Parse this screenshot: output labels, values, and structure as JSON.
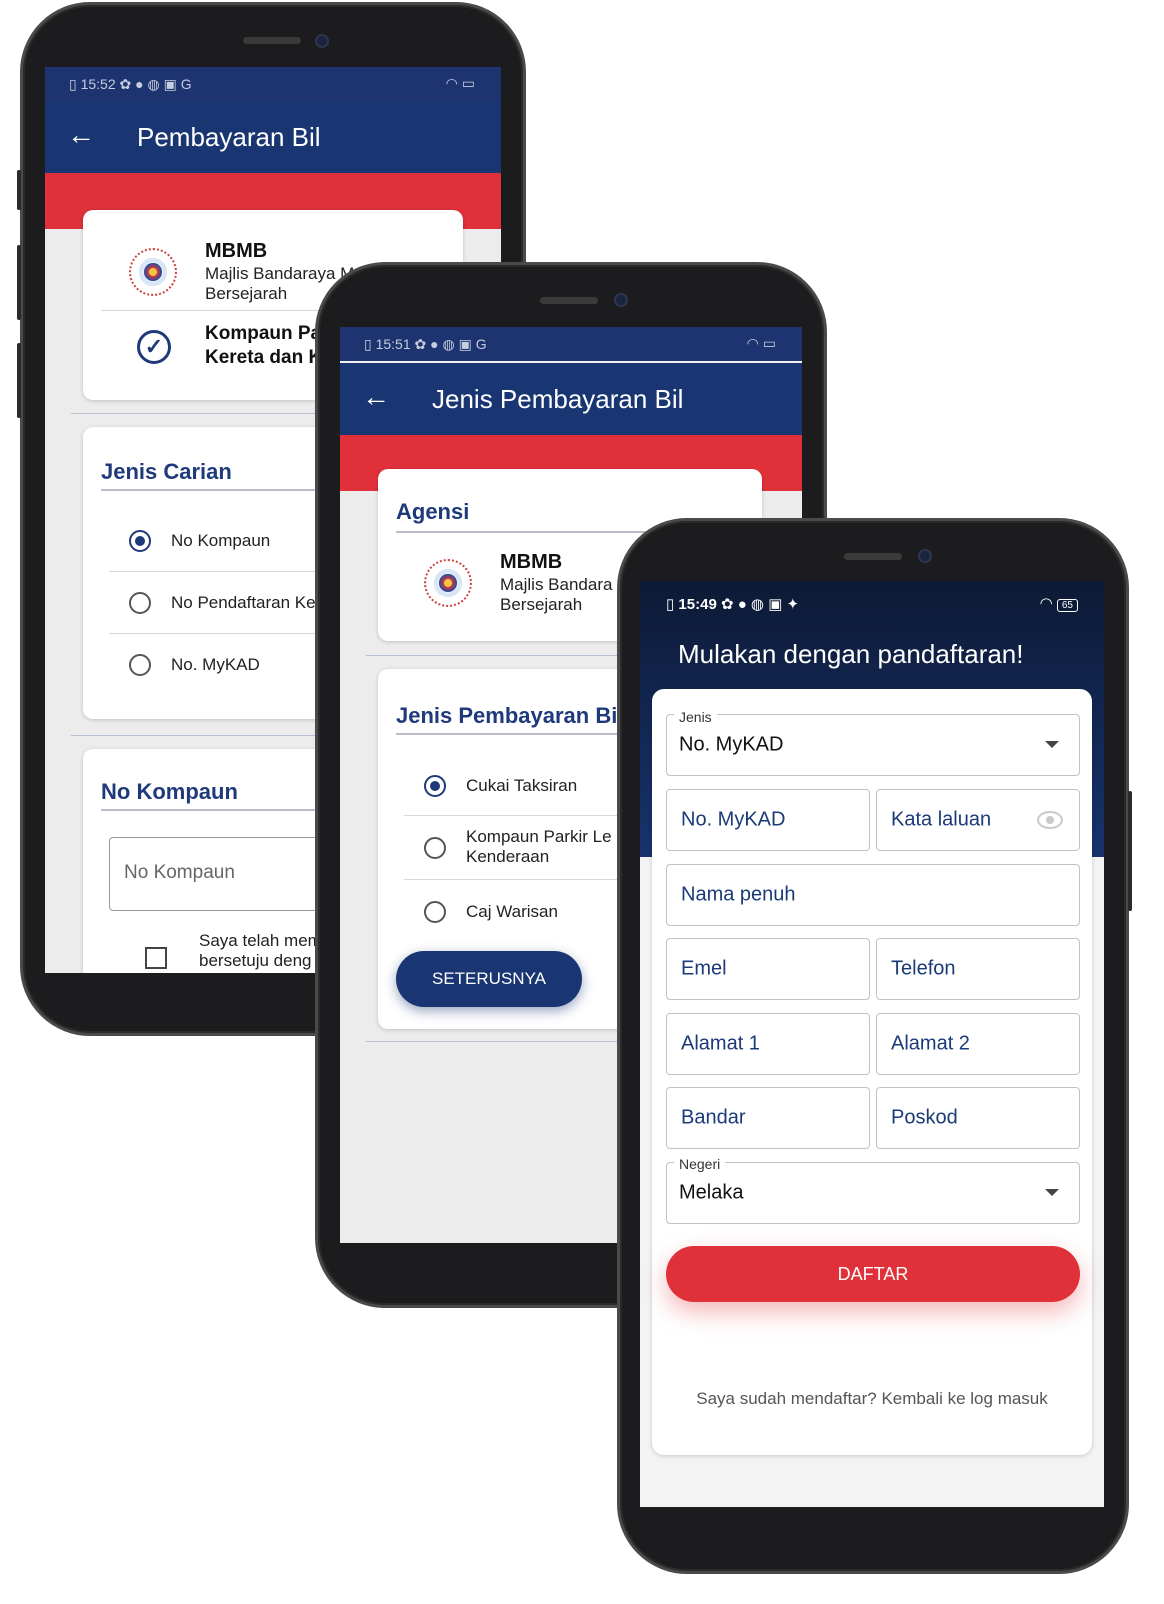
{
  "phone1": {
    "status_time": "15:52",
    "status_icons": "✿ ● ◍ ▣ G",
    "title": "Pembayaran Bil",
    "agency_code": "MBMB",
    "agency_name_line1": "Majlis Bandaraya Me",
    "agency_name_line2": "Bersejarah",
    "selected_line1": "Kompaun Pa",
    "selected_line2": "Kereta dan K",
    "search_section_title": "Jenis Carian",
    "search_options": [
      "No Kompaun",
      "No Pendaftaran Ke",
      "No. MyKAD"
    ],
    "selected_search": 0,
    "compound_section_title": "No Kompaun",
    "compound_placeholder": "No Kompaun",
    "agree_line1": "Saya telah mem",
    "agree_line2": "bersetuju deng"
  },
  "phone2": {
    "status_time": "15:51",
    "status_icons": "✿ ● ◍ ▣ G",
    "title": "Jenis Pembayaran Bil",
    "agency_section_title": "Agensi",
    "agency_code": "MBMB",
    "agency_name_line1": "Majlis Bandara",
    "agency_name_line2": "Bersejarah",
    "payment_section_title": "Jenis Pembayaran Bi",
    "payment_options": [
      "Cukai Taksiran",
      "Kompaun Parkir Le",
      "Caj Warisan"
    ],
    "payment_option2_line2": "Kenderaan",
    "selected_payment": 0,
    "next_button": "SETERUSNYA"
  },
  "phone3": {
    "status_time": "15:49",
    "status_icons": "✿ ● ◍ ▣ ✦",
    "battery": "65",
    "heading": "Mulakan dengan pandaftaran!",
    "type_label": "Jenis",
    "type_value": "No. MyKAD",
    "mykad_field": "No. MyKAD",
    "password_field": "Kata laluan",
    "fullname_field": "Nama penuh",
    "email_field": "Emel",
    "phone_field": "Telefon",
    "address1_field": "Alamat 1",
    "address2_field": "Alamat 2",
    "city_field": "Bandar",
    "postcode_field": "Poskod",
    "state_label": "Negeri",
    "state_value": "Melaka",
    "register_button": "DAFTAR",
    "login_link": "Saya sudah mendaftar? Kembali ke log masuk"
  },
  "colors": {
    "navy": "#193572",
    "red": "#e0313a",
    "title_blue": "#1f3a7a"
  }
}
